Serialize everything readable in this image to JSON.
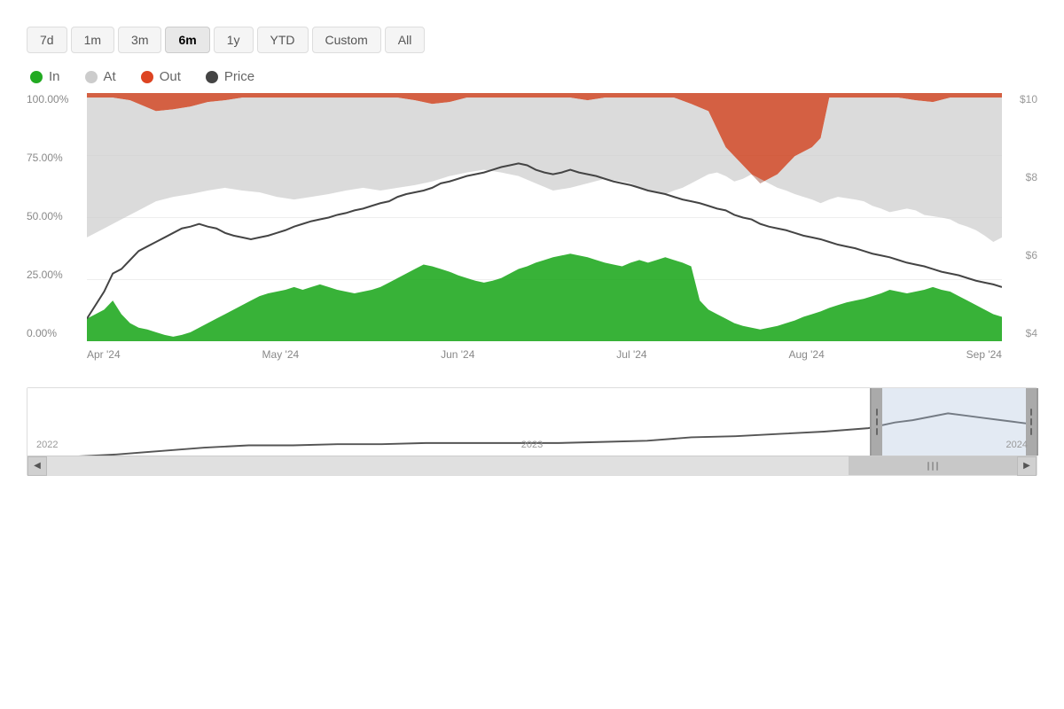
{
  "timeRange": {
    "buttons": [
      {
        "label": "7d",
        "active": false
      },
      {
        "label": "1m",
        "active": false
      },
      {
        "label": "3m",
        "active": false
      },
      {
        "label": "6m",
        "active": true
      },
      {
        "label": "1y",
        "active": false
      },
      {
        "label": "YTD",
        "active": false
      },
      {
        "label": "Custom",
        "active": false
      },
      {
        "label": "All",
        "active": false
      }
    ]
  },
  "legend": {
    "items": [
      {
        "label": "In",
        "color": "#22aa22"
      },
      {
        "label": "At",
        "color": "#cccccc"
      },
      {
        "label": "Out",
        "color": "#dd4422"
      },
      {
        "label": "Price",
        "color": "#444444"
      }
    ]
  },
  "yAxisLeft": [
    "100.00%",
    "75.00%",
    "50.00%",
    "25.00%",
    "0.00%"
  ],
  "yAxisRight": [
    "$10",
    "$8",
    "$6",
    "$4"
  ],
  "xLabels": [
    "Apr '24",
    "May '24",
    "Jun '24",
    "Jul '24",
    "Aug '24",
    "Sep '24"
  ],
  "navigator": {
    "yearLabels": [
      "2022",
      "2023",
      "2024"
    ]
  }
}
